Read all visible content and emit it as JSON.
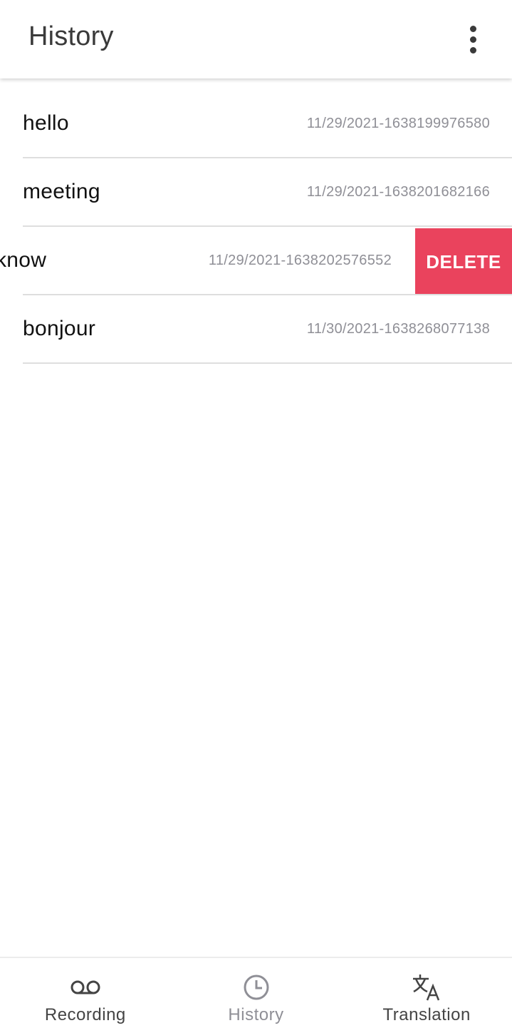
{
  "appbar": {
    "title": "History",
    "more_icon": "more-vert-icon"
  },
  "history": {
    "items": [
      {
        "title": "hello",
        "stamp": "11/29/2021-1638199976580"
      },
      {
        "title": "meeting",
        "stamp": "11/29/2021-1638201682166"
      },
      {
        "title": "know",
        "stamp": "11/29/2021-1638202576552",
        "delete_label": "DELETE"
      },
      {
        "title": "bonjour",
        "stamp": "11/30/2021-1638268077138"
      }
    ]
  },
  "nav": {
    "items": [
      {
        "label": "Recording",
        "icon": "voicemail-icon"
      },
      {
        "label": "History",
        "icon": "clock-icon",
        "active": true
      },
      {
        "label": "Translation",
        "icon": "translate-icon"
      }
    ]
  },
  "colors": {
    "delete": "#ea435d",
    "active_nav": "#8f8f96",
    "text": "#3a3a3a"
  }
}
